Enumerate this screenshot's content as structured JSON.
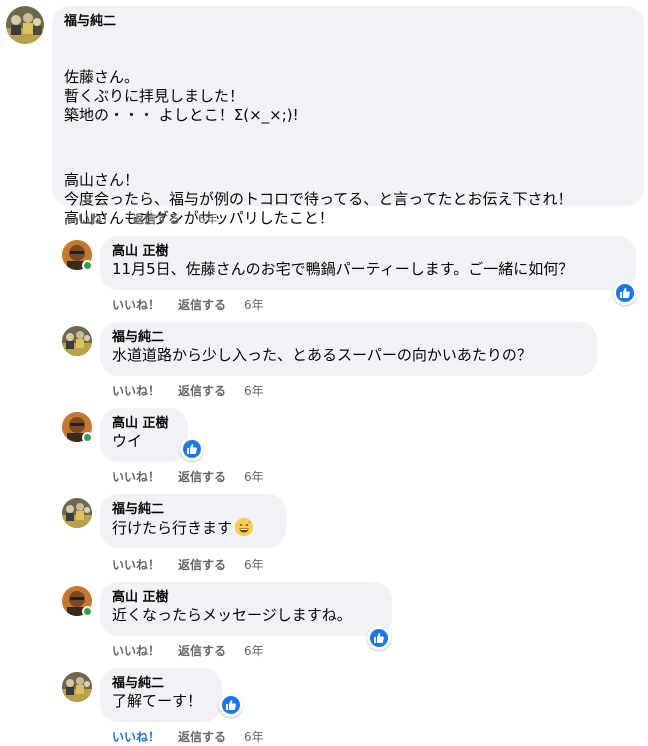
{
  "comments": [
    {
      "author": "福与純二",
      "paragraphs": [
        "佐藤さん。\n暫くぶりに拝見しました！\n築地の・・・ よしとこ！Σ(×_×;)!",
        "高山さん！\n今度会ったら、福与が例のトコロで待ってる、と言ってたとお伝え下され！\n高山さんもオグシがサッパリしたこと！"
      ],
      "like_label": "いいね！",
      "reply_label": "返信する",
      "time": "6年"
    }
  ],
  "replies": [
    {
      "author": "高山 正樹",
      "text": "11月5日、佐藤さんのお宅で鴨鍋パーティーします。ご一緒に如何？",
      "like_label": "いいね！",
      "reply_label": "返信する",
      "time": "6年",
      "reaction": "like"
    },
    {
      "author": "福与純二",
      "text": "水道道路から少し入った、とあるスーパーの向かいあたりの？",
      "like_label": "いいね！",
      "reply_label": "返信する",
      "time": "6年"
    },
    {
      "author": "高山 正樹",
      "text": "ウイ",
      "like_label": "いいね！",
      "reply_label": "返信する",
      "time": "6年",
      "reaction": "like"
    },
    {
      "author": "福与純二",
      "text": "行けたら行きます",
      "emoji": "grinning-sweat-emoji",
      "like_label": "いいね！",
      "reply_label": "返信する",
      "time": "6年"
    },
    {
      "author": "高山 正樹",
      "text": "近くなったらメッセージしますね。",
      "like_label": "いいね！",
      "reply_label": "返信する",
      "time": "6年",
      "reaction": "like"
    },
    {
      "author": "福与純二",
      "text": "了解てーす！",
      "like_label": "いいね！",
      "reply_label": "返信する",
      "time": "6年",
      "reaction": "like",
      "liked_by_viewer": true
    }
  ],
  "colors": {
    "bubble_bg": "#f0f2f5",
    "secondary_text": "#65676b",
    "like_blue": "#1877f2",
    "liked_text": "#1b74e4",
    "online_green": "#31a24c"
  },
  "icons": {
    "reaction": "thumbs-up-icon",
    "presence": "online-status-dot"
  }
}
